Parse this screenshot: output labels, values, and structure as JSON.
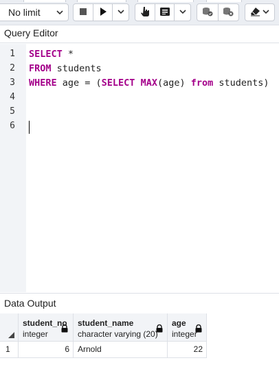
{
  "toolbar": {
    "limit_value": "No limit",
    "buttons": [
      "stop-icon",
      "play-icon",
      "chevron-down-icon",
      "hand-pointer-icon",
      "list-icon",
      "chevron-down-icon",
      "database-check-icon",
      "database-x-icon",
      "eraser-icon",
      "chevron-down-icon"
    ]
  },
  "editor": {
    "title": "Query Editor",
    "line_numbers": [
      "1",
      "2",
      "3",
      "4",
      "5",
      "6"
    ],
    "lines": [
      {
        "kw1": "SELECT",
        "rest1": " *"
      },
      {
        "kw1": "FROM",
        "rest1": " students"
      },
      {
        "kw1": "WHERE",
        "rest1": " age = (",
        "kw2": "SELECT MAX",
        "rest2": "(age) ",
        "kw3": "from",
        "rest3": " students)"
      }
    ]
  },
  "output": {
    "title": "Data Output",
    "columns": [
      {
        "name": "student_no",
        "type": "integer"
      },
      {
        "name": "student_name",
        "type": "character varying (20)"
      },
      {
        "name": "age",
        "type": "integer"
      }
    ],
    "rows": [
      {
        "row_no": "1",
        "student_no": "6",
        "student_name": "Arnold",
        "age": "22"
      }
    ]
  }
}
